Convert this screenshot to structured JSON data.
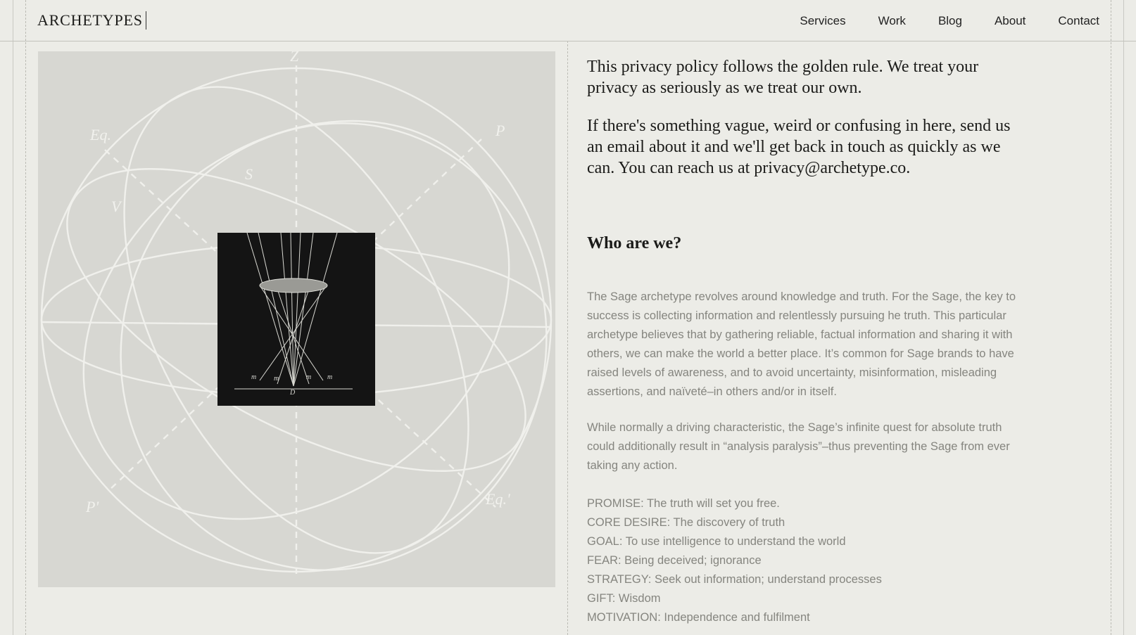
{
  "header": {
    "logo": "ARCHETYPES",
    "nav": [
      "Services",
      "Work",
      "Blog",
      "About",
      "Contact"
    ]
  },
  "artwork": {
    "labels": [
      "Z",
      "Eq.",
      "P",
      "S",
      "V",
      "P'",
      "Eq.'"
    ]
  },
  "intro": [
    "This privacy policy follows the golden rule. We treat your privacy as seriously as we treat our own.",
    "If there's something vague, weird or confusing in here, send us an email about it and we'll get back in touch as quickly as we can. You can reach us at privacy@archetype.co."
  ],
  "section": {
    "heading": "Who are we?",
    "paragraph1": "The Sage archetype revolves around knowledge and truth. For the Sage, the key to success is collecting information and relentlessly pursuing  he truth. This particular archetype believes that by gathering reliable, factual information and sharing it with others, we can make the world a better place. It’s common for Sage brands to have raised levels of awareness, and to avoid uncertainty, misinformation, misleading assertions, and naïveté–in others and/or in itself.",
    "paragraph2": "While normally a driving characteristic, the Sage’s infinite quest for absolute truth could additionally result in “analysis paralysis”–thus preventing the Sage from ever taking any action.",
    "attributes": [
      "PROMISE: The truth will set you free.",
      "CORE DESIRE: The discovery of truth",
      "GOAL: To use intelligence to understand the world",
      "FEAR: Being deceived; ignorance",
      "STRATEGY: Seek out information; understand processes",
      "GIFT: Wisdom",
      "MOTIVATION: Independence and fulfilment"
    ]
  }
}
